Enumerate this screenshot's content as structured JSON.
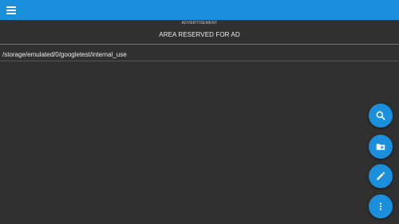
{
  "toolbar": {
    "color": "#1a8fdc",
    "menu_icon": "hamburger-menu-icon"
  },
  "ad": {
    "caption": "ADVERTISEMENT",
    "text": "AREA RESERVED FOR AD"
  },
  "path": {
    "current": "/storage/emulated/0/googletest/internal_use"
  },
  "fabs": [
    {
      "icon": "search-icon"
    },
    {
      "icon": "new-folder-icon"
    },
    {
      "icon": "pencil-icon"
    },
    {
      "icon": "more-vertical-icon"
    }
  ],
  "colors": {
    "accent": "#1a8fdc",
    "background": "#303030"
  }
}
